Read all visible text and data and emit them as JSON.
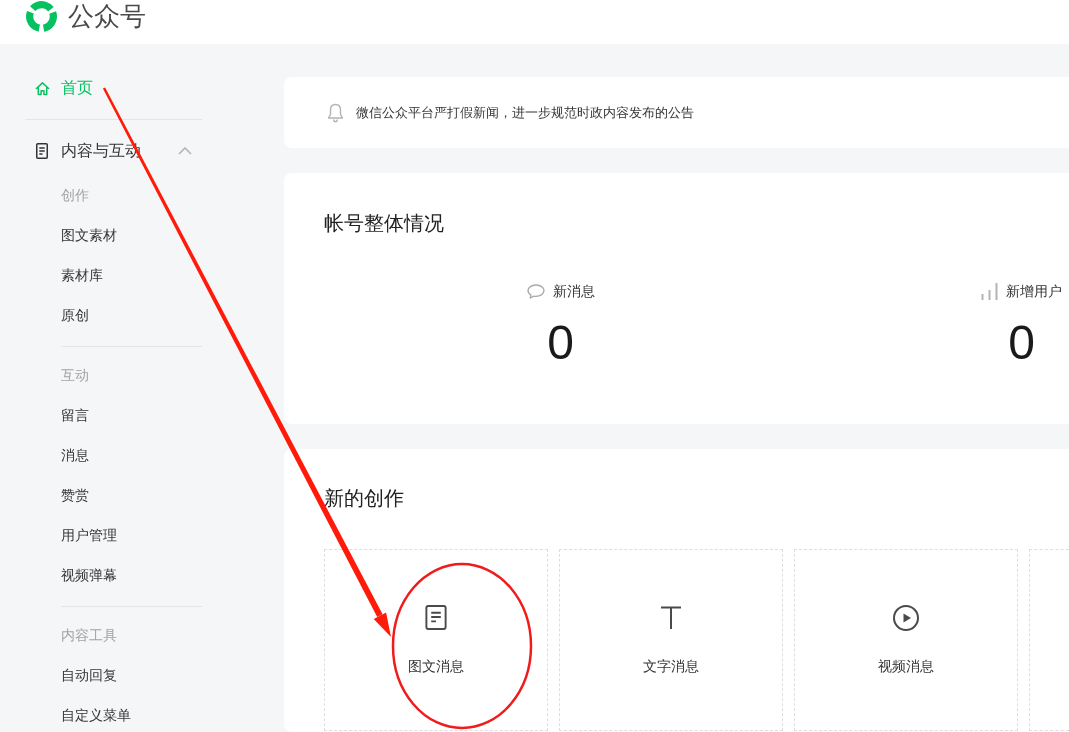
{
  "header": {
    "title": "公众号"
  },
  "sidebar": {
    "home": {
      "label": "首页",
      "selected": true
    },
    "section": {
      "label": "内容与互动",
      "expanded": true,
      "groups": [
        {
          "heading": "创作",
          "items": [
            {
              "label": "图文素材",
              "selected": false
            },
            {
              "label": "素材库",
              "selected": false
            },
            {
              "label": "原创",
              "selected": false
            }
          ]
        },
        {
          "heading": "互动",
          "items": [
            {
              "label": "留言",
              "selected": false
            },
            {
              "label": "消息",
              "selected": false
            },
            {
              "label": "赞赏",
              "selected": false
            },
            {
              "label": "用户管理",
              "selected": false
            },
            {
              "label": "视频弹幕",
              "selected": false
            }
          ]
        },
        {
          "heading": "内容工具",
          "items": [
            {
              "label": "自动回复",
              "selected": false
            },
            {
              "label": "自定义菜单",
              "selected": false
            }
          ]
        }
      ]
    }
  },
  "notice": {
    "text": "微信公众平台严打假新闻，进一步规范时政内容发布的公告"
  },
  "overview": {
    "title": "帐号整体情况",
    "stats": [
      {
        "kind": "messages",
        "label": "新消息",
        "value": "0"
      },
      {
        "kind": "users",
        "label": "新增用户",
        "value": "0"
      }
    ]
  },
  "creation": {
    "title": "新的创作",
    "tiles": [
      {
        "kind": "article",
        "label": "图文消息"
      },
      {
        "kind": "text",
        "label": "文字消息"
      },
      {
        "kind": "video",
        "label": "视频消息"
      },
      {
        "kind": "clipped"
      }
    ]
  }
}
